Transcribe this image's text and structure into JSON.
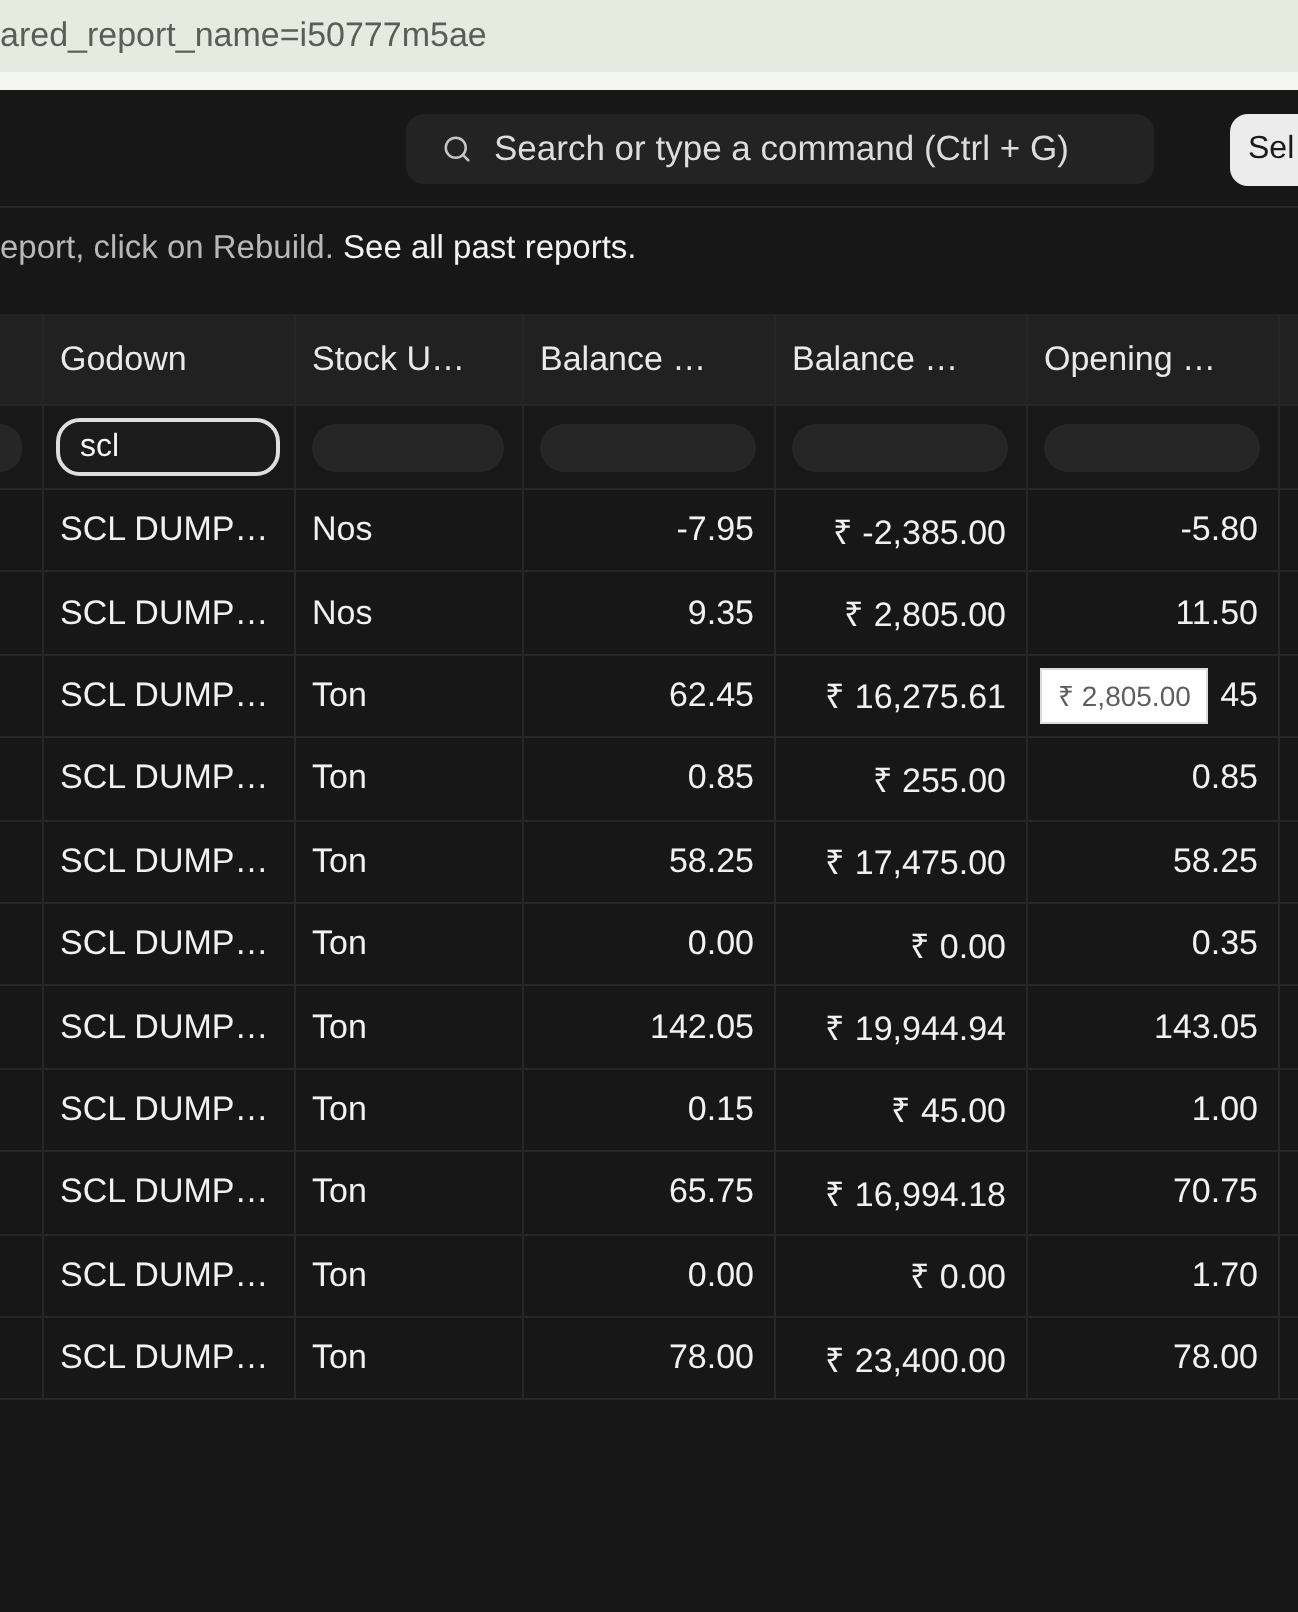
{
  "address_bar": {
    "url": "ared_report_name=i50777m5ae"
  },
  "toolbar": {
    "search": {
      "placeholder": "Search or type a command (Ctrl + G)"
    },
    "button": "Sel"
  },
  "notice": {
    "text": "eport, click on Rebuild.",
    "link": "See all past reports."
  },
  "table": {
    "columns": [
      {
        "kind": "text",
        "label": "Godown",
        "filter": {
          "focused": true,
          "value": "scl"
        }
      },
      {
        "kind": "text",
        "label": "Stock U…",
        "filter": {
          "focused": false
        }
      },
      {
        "kind": "number",
        "label": "Balance …",
        "filter": {
          "focused": false
        }
      },
      {
        "kind": "number",
        "label": "Balance …",
        "filter": {
          "focused": false
        }
      },
      {
        "kind": "number",
        "label": "Opening …",
        "filter": {
          "focused": false
        }
      }
    ],
    "rows": [
      {
        "cells": [
          "SCL DUMP…",
          "Nos",
          "-7.95",
          "₹ -2,385.00",
          "-5.80"
        ]
      },
      {
        "cells": [
          "SCL DUMP…",
          "Nos",
          "9.35",
          "₹ 2,805.00",
          "11.50"
        ]
      },
      {
        "cells": [
          "SCL DUMP…",
          "Ton",
          "62.45",
          "₹ 16,275.61",
          {
            "text": "45",
            "tooltip": "₹ 2,805.00"
          }
        ]
      },
      {
        "cells": [
          "SCL DUMP…",
          "Ton",
          "0.85",
          "₹ 255.00",
          "0.85"
        ]
      },
      {
        "cells": [
          "SCL DUMP…",
          "Ton",
          "58.25",
          "₹ 17,475.00",
          "58.25"
        ]
      },
      {
        "cells": [
          "SCL DUMP…",
          "Ton",
          "0.00",
          "₹ 0.00",
          "0.35"
        ]
      },
      {
        "cells": [
          "SCL DUMP…",
          "Ton",
          "142.05",
          "₹ 19,944.94",
          "143.05"
        ]
      },
      {
        "cells": [
          "SCL DUMP…",
          "Ton",
          "0.15",
          "₹ 45.00",
          "1.00"
        ]
      },
      {
        "cells": [
          "SCL DUMP…",
          "Ton",
          "65.75",
          "₹ 16,994.18",
          "70.75"
        ]
      },
      {
        "cells": [
          "SCL DUMP…",
          "Ton",
          "0.00",
          "₹ 0.00",
          "1.70"
        ]
      },
      {
        "cells": [
          "SCL DUMP…",
          "Ton",
          "78.00",
          "₹ 23,400.00",
          "78.00"
        ]
      }
    ]
  }
}
